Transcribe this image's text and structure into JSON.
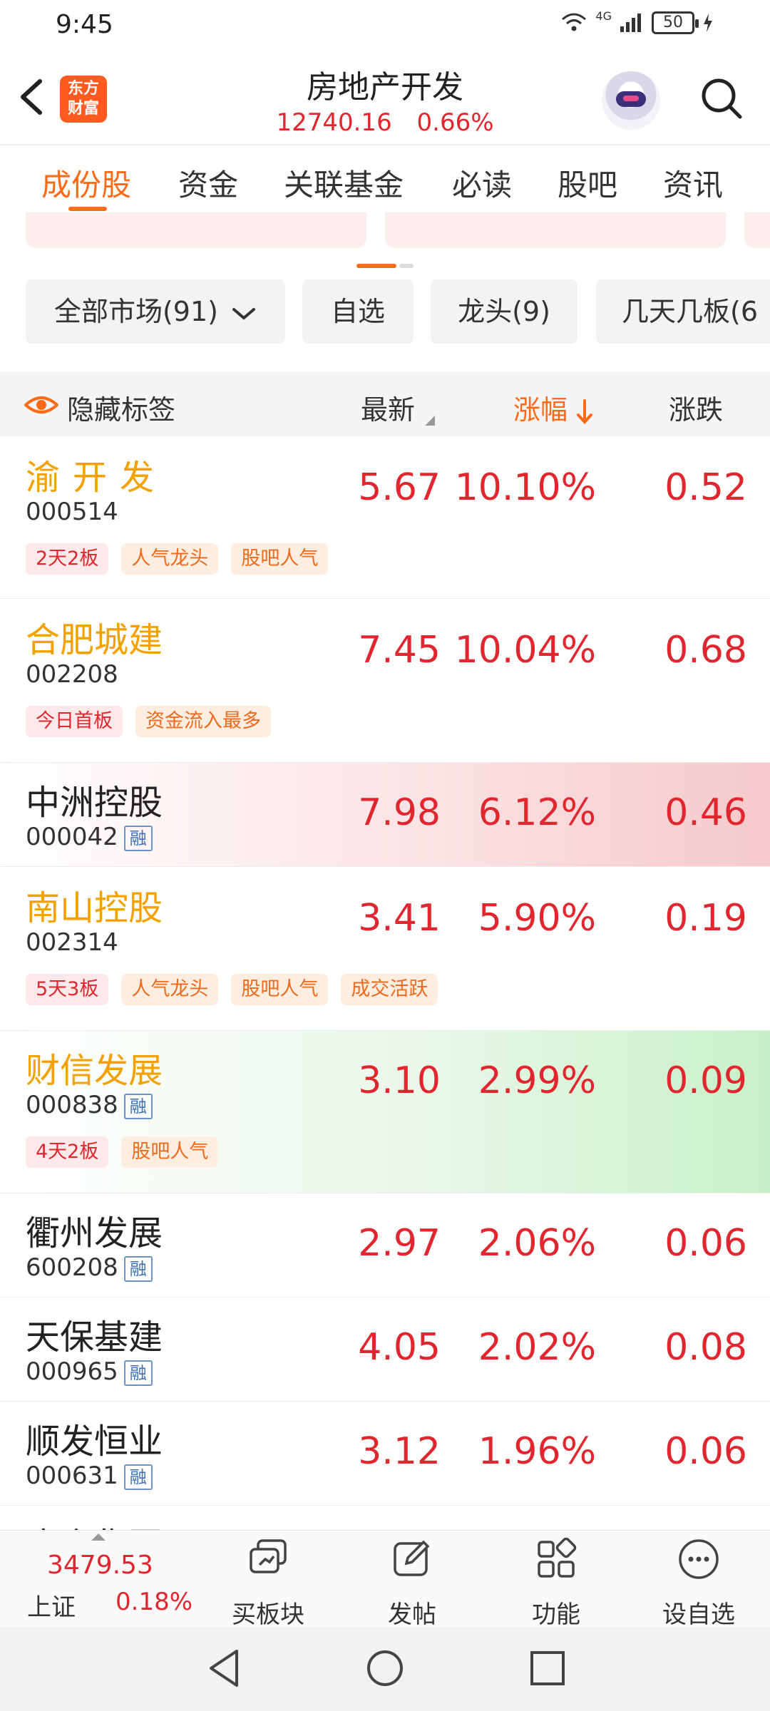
{
  "status_bar": {
    "time": "9:45",
    "network": "4G",
    "battery": "50"
  },
  "header": {
    "back_icon": "chevron-left-icon",
    "logo_text_1": "东方",
    "logo_text_2": "财富",
    "title": "房地产开发",
    "index_value": "12740.16",
    "index_change": "0.66%"
  },
  "tabs": [
    {
      "label": "成份股",
      "active": true
    },
    {
      "label": "资金"
    },
    {
      "label": "关联基金"
    },
    {
      "label": "必读"
    },
    {
      "label": "股吧"
    },
    {
      "label": "资讯"
    }
  ],
  "filters": {
    "market": "全部市场(91)",
    "watchlist": "自选",
    "leaders": "龙头(9)",
    "streak": "几天几板(6"
  },
  "table_header": {
    "hide_tags": "隐藏标签",
    "latest": "最新",
    "change_pct": "涨幅",
    "change": "涨跌"
  },
  "rows": [
    {
      "name": "渝开发",
      "code": "000514",
      "price": "5.67",
      "pct": "10.10%",
      "chg": "0.52",
      "rong": false,
      "tags": [
        {
          "text": "2天2板",
          "style": "red"
        },
        {
          "text": "人气龙头",
          "style": "org"
        },
        {
          "text": "股吧人气",
          "style": "org"
        }
      ]
    },
    {
      "name": "合肥城建",
      "code": "002208",
      "price": "7.45",
      "pct": "10.04%",
      "chg": "0.68",
      "rong": false,
      "tags": [
        {
          "text": "今日首板",
          "style": "red"
        },
        {
          "text": "资金流入最多",
          "style": "org"
        }
      ]
    },
    {
      "name": "中洲控股",
      "code": "000042",
      "price": "7.98",
      "pct": "6.12%",
      "chg": "0.46",
      "rong": true,
      "tags": []
    },
    {
      "name": "南山控股",
      "code": "002314",
      "price": "3.41",
      "pct": "5.90%",
      "chg": "0.19",
      "rong": false,
      "tags": [
        {
          "text": "5天3板",
          "style": "red"
        },
        {
          "text": "人气龙头",
          "style": "org"
        },
        {
          "text": "股吧人气",
          "style": "org"
        },
        {
          "text": "成交活跃",
          "style": "org"
        }
      ]
    },
    {
      "name": "财信发展",
      "code": "000838",
      "price": "3.10",
      "pct": "2.99%",
      "chg": "0.09",
      "rong": true,
      "tags": [
        {
          "text": "4天2板",
          "style": "red"
        },
        {
          "text": "股吧人气",
          "style": "org"
        }
      ]
    },
    {
      "name": "衢州发展",
      "code": "600208",
      "price": "2.97",
      "pct": "2.06%",
      "chg": "0.06",
      "rong": true,
      "tags": []
    },
    {
      "name": "天保基建",
      "code": "000965",
      "price": "4.05",
      "pct": "2.02%",
      "chg": "0.08",
      "rong": true,
      "tags": []
    },
    {
      "name": "顺发恒业",
      "code": "000631",
      "price": "3.12",
      "pct": "1.96%",
      "chg": "0.06",
      "rong": true,
      "tags": []
    }
  ],
  "rong_label": "融",
  "partial_row_name": "广宇集团",
  "bottom_bar": {
    "index_value": "3479.53",
    "index_name": "上证",
    "index_pct": "0.18%",
    "items": [
      "买板块",
      "发帖",
      "功能",
      "设自选"
    ]
  },
  "colors": {
    "accent": "#ff6a16",
    "up": "#e0262e",
    "highlight_name": "#f2a100"
  }
}
